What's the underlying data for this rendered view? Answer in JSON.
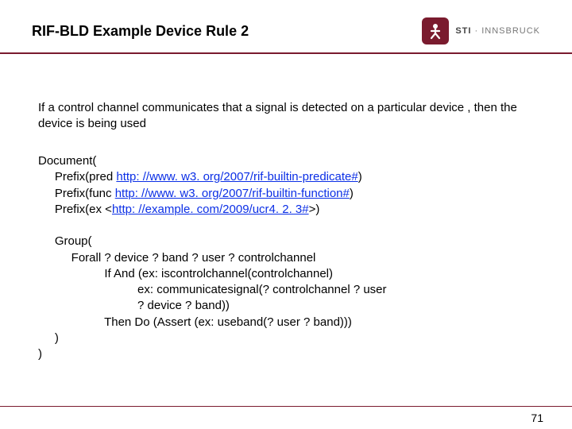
{
  "header": {
    "title": "RIF-BLD Example Device Rule 2",
    "logo": {
      "brand_bold": "STI",
      "brand_light": " · INNSBRUCK"
    }
  },
  "intro": "If a control channel communicates that a signal is detected on a particular device , then the device is being used",
  "code": {
    "l1": "Document(",
    "l2a": "     Prefix(pred ",
    "l2link": "http: //www. w3. org/2007/rif-builtin-predicate#",
    "l2b": ")",
    "l3a": "     Prefix(func ",
    "l3link": "http: //www. w3. org/2007/rif-builtin-function#",
    "l3b": ")",
    "l4a": "     Prefix(ex <",
    "l4link": "http: //example. com/2009/ucr4. 2. 3#",
    "l4b": ">)",
    "l5": "     Group(",
    "l6": "          Forall ? device ? band ? user ? controlchannel",
    "l7": "                    If And (ex: iscontrolchannel(controlchannel)",
    "l8": "                              ex: communicatesignal(? controlchannel ? user",
    "l9": "                              ? device ? band))",
    "l10": "                    Then Do (Assert (ex: useband(? user ? band)))",
    "l11": "     )",
    "l12": ")"
  },
  "page": "71"
}
